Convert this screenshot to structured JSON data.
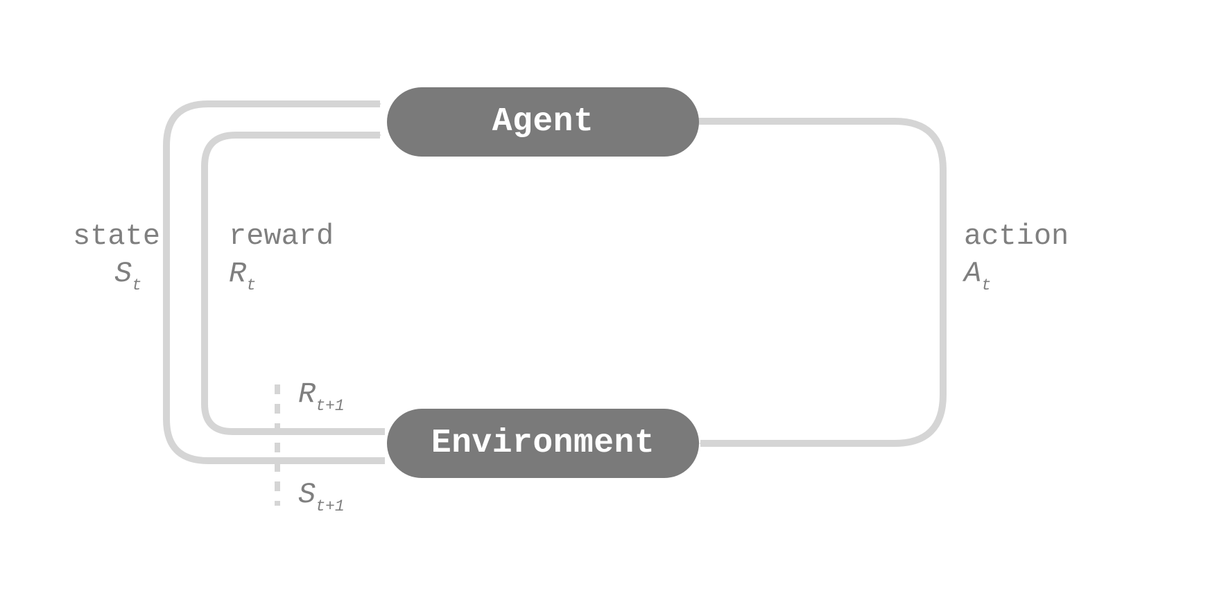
{
  "nodes": {
    "agent": "Agent",
    "environment": "Environment"
  },
  "labels": {
    "state_word": "state",
    "state_sym": "S",
    "state_sub": "t",
    "reward_word": "reward",
    "reward_sym": "R",
    "reward_sub": "t",
    "action_word": "action",
    "action_sym": "A",
    "action_sub": "t",
    "reward_next_sym": "R",
    "reward_next_sub": "t+1",
    "state_next_sym": "S",
    "state_next_sub": "t+1"
  },
  "colors": {
    "node_fill": "#7a7a7a",
    "node_text": "#ffffff",
    "arrow": "#d5d5d5",
    "text": "#7f7f7f",
    "bg": "#ffffff"
  }
}
